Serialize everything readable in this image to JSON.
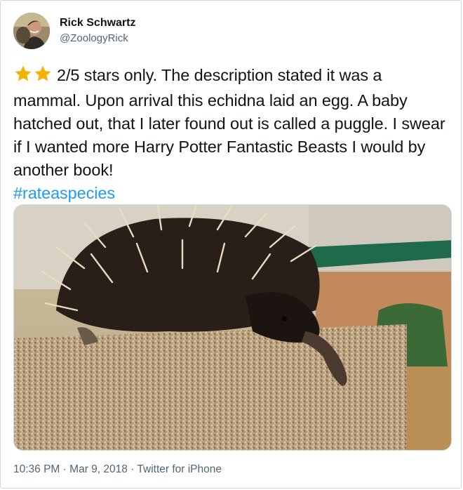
{
  "user": {
    "display_name": "Rick Schwartz",
    "handle": "@ZoologyRick"
  },
  "tweet": {
    "rating_icon": "star-icon",
    "star_count": 2,
    "star_color": "#f5b301",
    "body": "2/5 stars only. The description stated it was a mammal. Upon arrival this echidna laid an egg. A baby hatched out, that I later found out is called a puggle. I swear if I wanted more Harry Potter Fantastic Beasts I would by another book!",
    "hashtag": "#rateaspecies",
    "hashtag_color": "#1d9bf0"
  },
  "footer": {
    "time": "10:36 PM",
    "date": "Mar 9, 2018",
    "source": "Twitter for iPhone",
    "separator": "·"
  }
}
